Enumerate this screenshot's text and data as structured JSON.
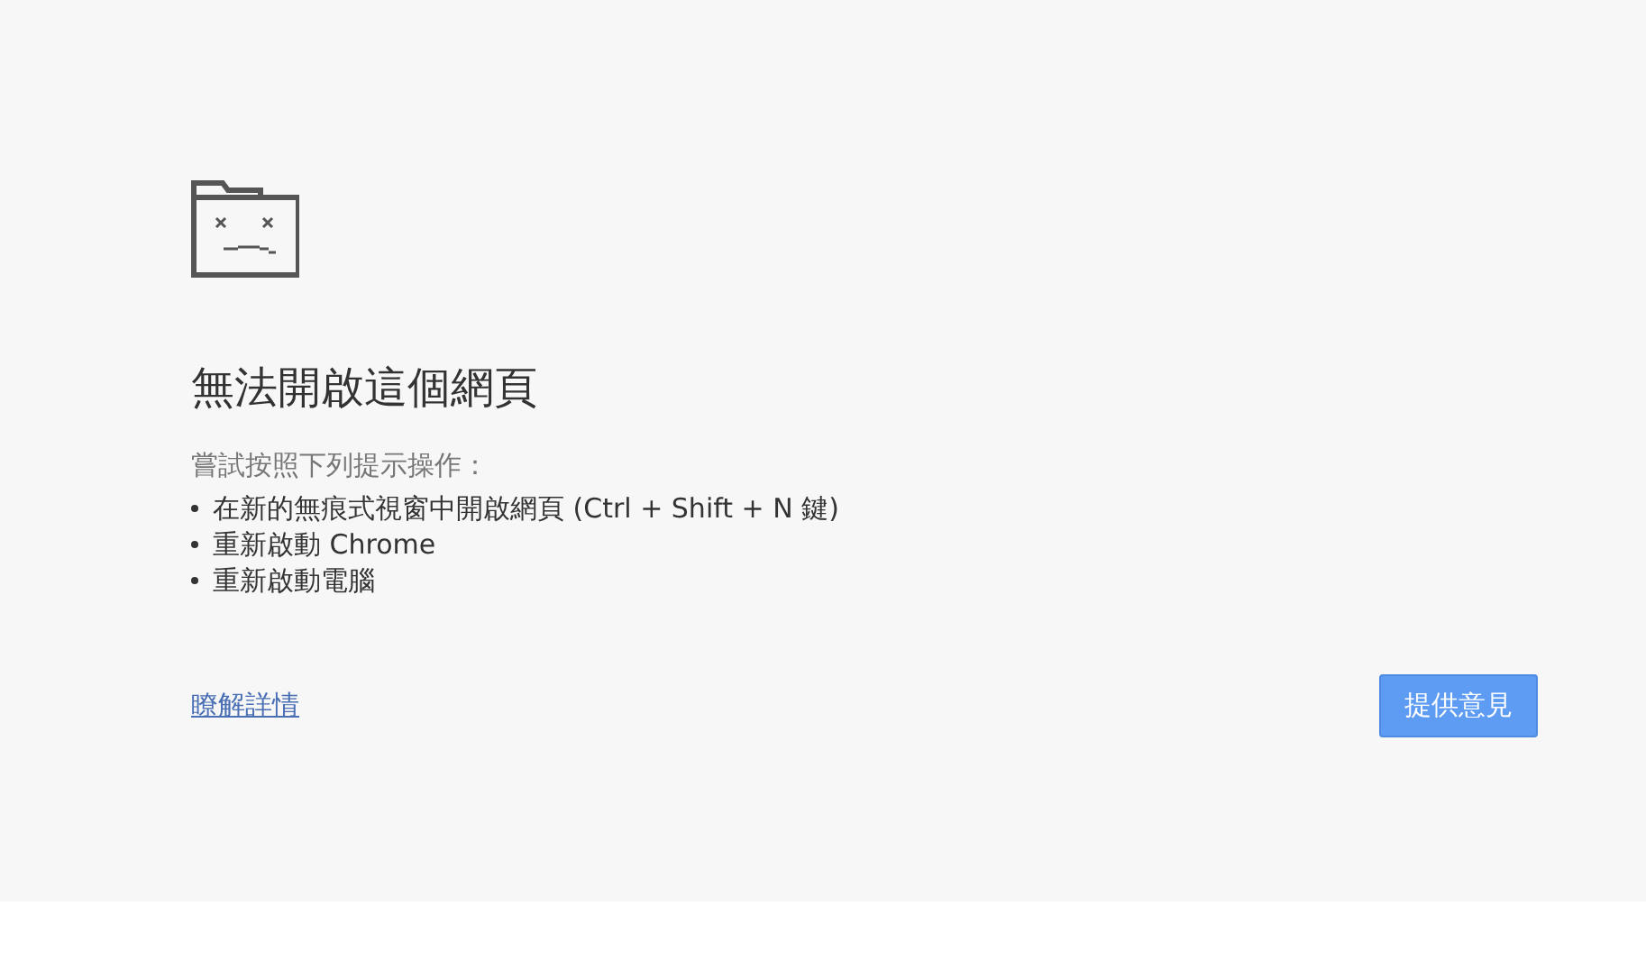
{
  "error_page": {
    "title": "無法開啟這個網頁",
    "suggestions_heading": "嘗試按照下列提示操作：",
    "suggestions": [
      "在新的無痕式視窗中開啟網頁 (Ctrl + Shift + N 鍵)",
      "重新啟動 Chrome",
      "重新啟動電腦"
    ],
    "details_link": "瞭解詳情",
    "feedback_button": "提供意見"
  }
}
